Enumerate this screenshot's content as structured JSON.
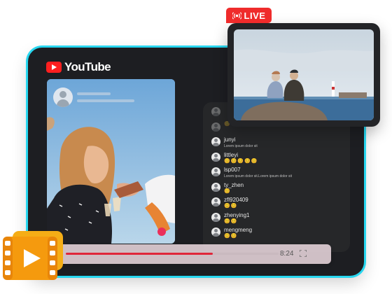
{
  "app": {
    "brand": "YouTube"
  },
  "live": {
    "badge": "LIVE"
  },
  "chat": {
    "rows": [
      {
        "name": "",
        "message": "",
        "emoji": "",
        "faded": true
      },
      {
        "name": "",
        "message": "",
        "emoji": "😊",
        "faded": true
      },
      {
        "name": "junyi",
        "message": "Lorem ipsum dolor sit",
        "emoji": ""
      },
      {
        "name": "littleyi",
        "message": "",
        "emoji": "😊😊😊😊😊"
      },
      {
        "name": "lsp007",
        "message": "Lorem ipsum dolor sit.Lorem ipsum dolor sit",
        "emoji": ""
      },
      {
        "name": "ty_zhen",
        "message": "",
        "emoji": "😊"
      },
      {
        "name": "zfl920409",
        "message": "",
        "emoji": "😊😊"
      },
      {
        "name": "zhenying1",
        "message": "",
        "emoji": "😊😊"
      },
      {
        "name": "mengmeng",
        "message": "",
        "emoji": "😊😊"
      }
    ]
  },
  "player": {
    "time": "8:24",
    "progress": 0.69
  },
  "icons": {
    "brand": "youtube-logo-icon",
    "live": "broadcast-icon",
    "fullscreen": "fullscreen-icon",
    "film": "video-play-icon",
    "avatar": "user-avatar-icon"
  },
  "colors": {
    "accent": "#28d7f0",
    "live": "#ef2b2b",
    "progress": "#e0263a",
    "film": "#f5a40e"
  }
}
